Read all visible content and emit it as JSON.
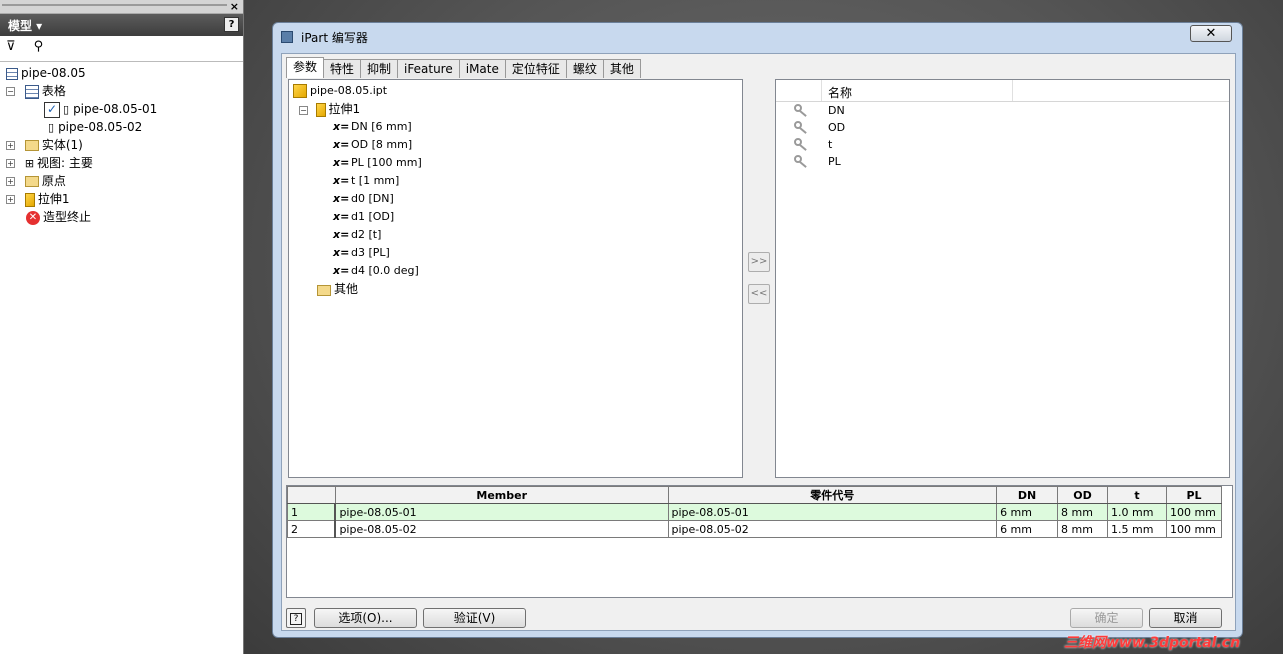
{
  "browser": {
    "title": "模型 ▾",
    "help": "?",
    "close": "×",
    "filter_icon": "filter-icon",
    "find_icon": "binoculars-icon",
    "tree": [
      {
        "label": "pipe-08.05",
        "icon": "assembly-icon",
        "expander": "",
        "level": 0
      },
      {
        "label": "表格",
        "icon": "table-icon",
        "expander": "−",
        "level": 1
      },
      {
        "label": "pipe-08.05-01",
        "icon": "member-icon",
        "expander": "",
        "level": 2,
        "checked": true
      },
      {
        "label": "pipe-08.05-02",
        "icon": "member-icon",
        "expander": "",
        "level": 2
      },
      {
        "label": "实体(1)",
        "icon": "solid-folder-icon",
        "expander": "+",
        "level": 1
      },
      {
        "label": "视图: 主要",
        "icon": "view-icon",
        "expander": "+",
        "level": 1
      },
      {
        "label": "原点",
        "icon": "folder-icon",
        "expander": "+",
        "level": 1
      },
      {
        "label": "拉伸1",
        "icon": "extrude-icon",
        "expander": "+",
        "level": 1
      },
      {
        "label": "造型终止",
        "icon": "end-of-part-icon",
        "expander": "",
        "level": 1
      }
    ]
  },
  "dialog": {
    "title": "iPart 编写器",
    "close": "✕",
    "tabs": [
      "参数",
      "特性",
      "抑制",
      "iFeature",
      "iMate",
      "定位特征",
      "螺纹",
      "其他"
    ],
    "selected_tab": 0,
    "left_tree": {
      "root": "pipe-08.05.ipt",
      "feature": "拉伸1",
      "params": [
        "DN [6 mm]",
        "OD [8 mm]",
        "PL [100 mm]",
        "t [1 mm]",
        "d0 [DN]",
        "d1 [OD]",
        "d2 [t]",
        "d3 [PL]",
        "d4 [0.0 deg]"
      ],
      "other": "其他"
    },
    "add_btn": ">>",
    "remove_btn": "<<",
    "right_list": {
      "header": "名称",
      "items": [
        "DN",
        "OD",
        "t",
        "PL"
      ]
    },
    "table": {
      "columns": [
        "Member",
        "零件代号",
        "DN",
        "OD",
        "t",
        "PL"
      ],
      "rows": [
        {
          "n": "1",
          "member": "pipe-08.05-01",
          "part": "pipe-08.05-01",
          "dn": "6 mm",
          "od": "8 mm",
          "t": "1.0 mm",
          "pl": "100 mm"
        },
        {
          "n": "2",
          "member": "pipe-08.05-02",
          "part": "pipe-08.05-02",
          "dn": "6 mm",
          "od": "8 mm",
          "t": "1.5 mm",
          "pl": "100 mm"
        }
      ]
    },
    "buttons": {
      "help": "?",
      "options": "选项(O)...",
      "verify": "验证(V)",
      "ok": "确定",
      "cancel": "取消"
    }
  },
  "watermark": "三维网www.3dportal.cn"
}
